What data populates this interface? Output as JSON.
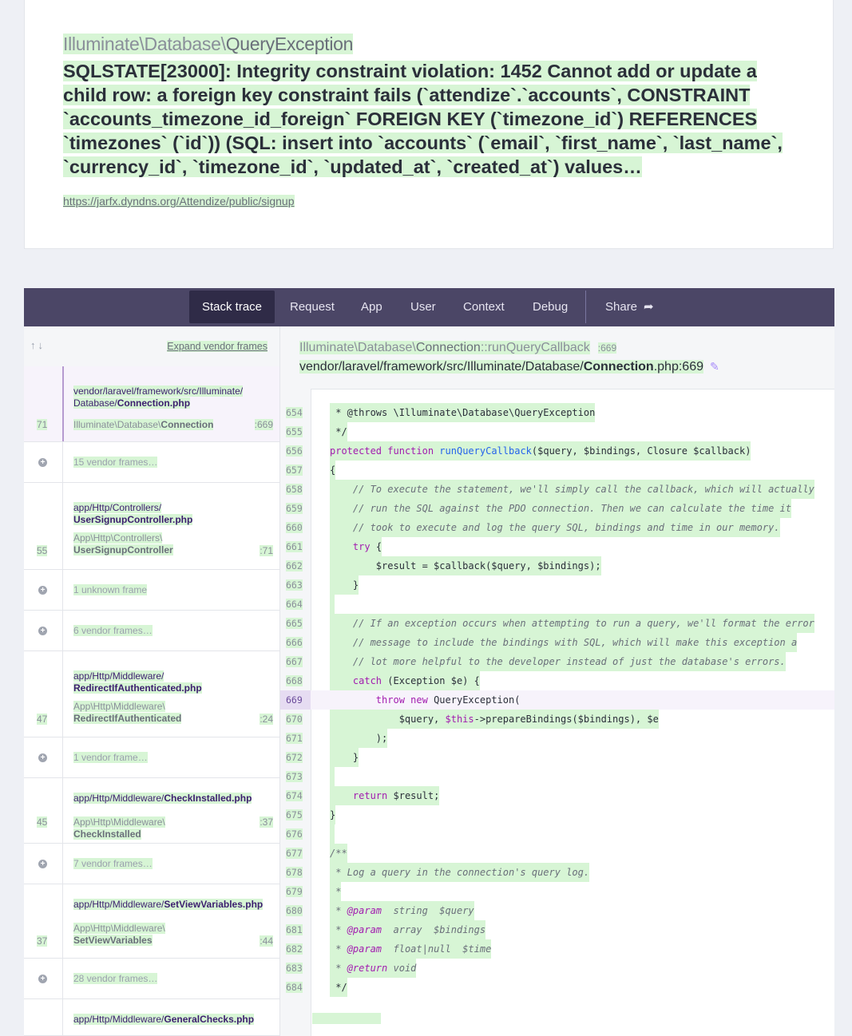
{
  "exception": {
    "class_prefix": "Illuminate\\Database\\",
    "class_name": "QueryException",
    "message": "SQLSTATE[23000]: Integrity constraint violation: 1452 Cannot add or update a child row: a foreign key constraint fails (`attendize`.`accounts`, CONSTRAINT `accounts_timezone_id_foreign` FOREIGN KEY (`timezone_id`) REFERENCES `timezones` (`id`)) (SQL: insert into `accounts` (`email`, `first_name`, `last_name`, `currency_id`, `timezone_id`, `updated_at`, `created_at`) values…",
    "url": "https://jarfx.dyndns.org/Attendize/public/signup"
  },
  "tabs": [
    "Stack trace",
    "Request",
    "App",
    "User",
    "Context",
    "Debug",
    "Share"
  ],
  "frames_header": {
    "arrows": "↑↓",
    "expand_label": "Expand vendor frames"
  },
  "frames": [
    {
      "num": "71",
      "path_prefix": "vendor/laravel/framework/src/Illuminate/",
      "path_dir": "Database/",
      "path_file": "Connection.php",
      "cls_prefix": "Illuminate\\Database\\",
      "cls_name": "Connection",
      "line": ":669"
    },
    {
      "vendor": "15 vendor frames…"
    },
    {
      "num": "55",
      "path_prefix": "app/Http/Controllers/",
      "path_file": "UserSignupController.php",
      "cls_prefix": "App\\Http\\Controllers\\",
      "cls_name": "UserSignupController",
      "line": ":71"
    },
    {
      "vendor": "1 unknown frame"
    },
    {
      "vendor": "6 vendor frames…"
    },
    {
      "num": "47",
      "path_prefix": "app/Http/Middleware/",
      "path_file": "RedirectIfAuthenticated.php",
      "cls_prefix": "App\\Http\\Middleware\\",
      "cls_name": "RedirectIfAuthenticated",
      "line": ":24"
    },
    {
      "vendor": "1 vendor frame…"
    },
    {
      "num": "45",
      "path_prefix": "app/Http/Middleware/",
      "path_file": "CheckInstalled.php",
      "cls_prefix": "App\\Http\\Middleware\\",
      "cls_name": "CheckInstalled",
      "line": ":37"
    },
    {
      "vendor": "7 vendor frames…"
    },
    {
      "num": "37",
      "path_prefix": "app/Http/Middleware/",
      "path_file": "SetViewVariables.php",
      "cls_prefix": "App\\Http\\Middleware\\",
      "cls_name": "SetViewVariables",
      "line": ":44"
    },
    {
      "vendor": "28 vendor frames…"
    },
    {
      "path_prefix": "app/Http/Middleware/",
      "path_file": "GeneralChecks.php"
    }
  ],
  "code_header": {
    "class_prefix": "Illuminate\\Database\\",
    "class_name": "Connection",
    "method": "::runQueryCallback",
    "line": ":669",
    "file_prefix": "vendor/laravel/framework/src/Illuminate/Database/",
    "file_name": "Connection",
    "file_ext": ".php:669"
  },
  "code": [
    {
      "n": "654",
      "t": "     * @throws \\Illuminate\\Database\\QueryException"
    },
    {
      "n": "655",
      "t": "     */"
    },
    {
      "n": "656",
      "t": "    protected function runQueryCallback($query, $bindings, Closure $callback)"
    },
    {
      "n": "657",
      "t": "    {"
    },
    {
      "n": "658",
      "t": "        // To execute the statement, we'll simply call the callback, which will actually"
    },
    {
      "n": "659",
      "t": "        // run the SQL against the PDO connection. Then we can calculate the time it"
    },
    {
      "n": "660",
      "t": "        // took to execute and log the query SQL, bindings and time in our memory."
    },
    {
      "n": "661",
      "t": "        try {"
    },
    {
      "n": "662",
      "t": "            $result = $callback($query, $bindings);"
    },
    {
      "n": "663",
      "t": "        }"
    },
    {
      "n": "664",
      "t": ""
    },
    {
      "n": "665",
      "t": "        // If an exception occurs when attempting to run a query, we'll format the error"
    },
    {
      "n": "666",
      "t": "        // message to include the bindings with SQL, which will make this exception a"
    },
    {
      "n": "667",
      "t": "        // lot more helpful to the developer instead of just the database's errors."
    },
    {
      "n": "668",
      "t": "        catch (Exception $e) {"
    },
    {
      "n": "669",
      "t": "            throw new QueryException("
    },
    {
      "n": "670",
      "t": "                $query, $this->prepareBindings($bindings), $e"
    },
    {
      "n": "671",
      "t": "            );"
    },
    {
      "n": "672",
      "t": "        }"
    },
    {
      "n": "673",
      "t": ""
    },
    {
      "n": "674",
      "t": "        return $result;"
    },
    {
      "n": "675",
      "t": "    }"
    },
    {
      "n": "676",
      "t": ""
    },
    {
      "n": "677",
      "t": "    /**"
    },
    {
      "n": "678",
      "t": "     * Log a query in the connection's query log."
    },
    {
      "n": "679",
      "t": "     *"
    },
    {
      "n": "680",
      "t": "     * @param  string  $query"
    },
    {
      "n": "681",
      "t": "     * @param  array  $bindings"
    },
    {
      "n": "682",
      "t": "     * @param  float|null  $time"
    },
    {
      "n": "683",
      "t": "     * @return void"
    },
    {
      "n": "684",
      "t": "     */"
    }
  ],
  "active_line": "669",
  "colors": {
    "tab_bar": "#4b4666",
    "tab_active": "#2f2b47",
    "highlight": "#d7f5d5",
    "keyword": "#a21caf",
    "function": "#2563eb"
  }
}
